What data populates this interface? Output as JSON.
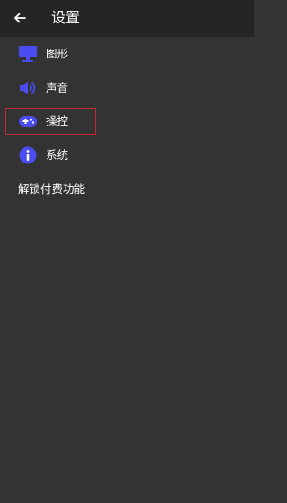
{
  "header": {
    "title": "设置",
    "back_icon": "arrow-left-icon"
  },
  "menu": {
    "items": [
      {
        "label": "图形",
        "icon": "monitor-icon"
      },
      {
        "label": "声音",
        "icon": "volume-icon"
      },
      {
        "label": "操控",
        "icon": "gamepad-icon",
        "selected": true
      },
      {
        "label": "系统",
        "icon": "info-icon"
      }
    ],
    "unlock_label": "解锁付费功能"
  },
  "colors": {
    "background": "#333333",
    "app_bar": "#252525",
    "accent": "#4b4cf0",
    "selection_border": "#c32833",
    "text": "#ffffff"
  }
}
